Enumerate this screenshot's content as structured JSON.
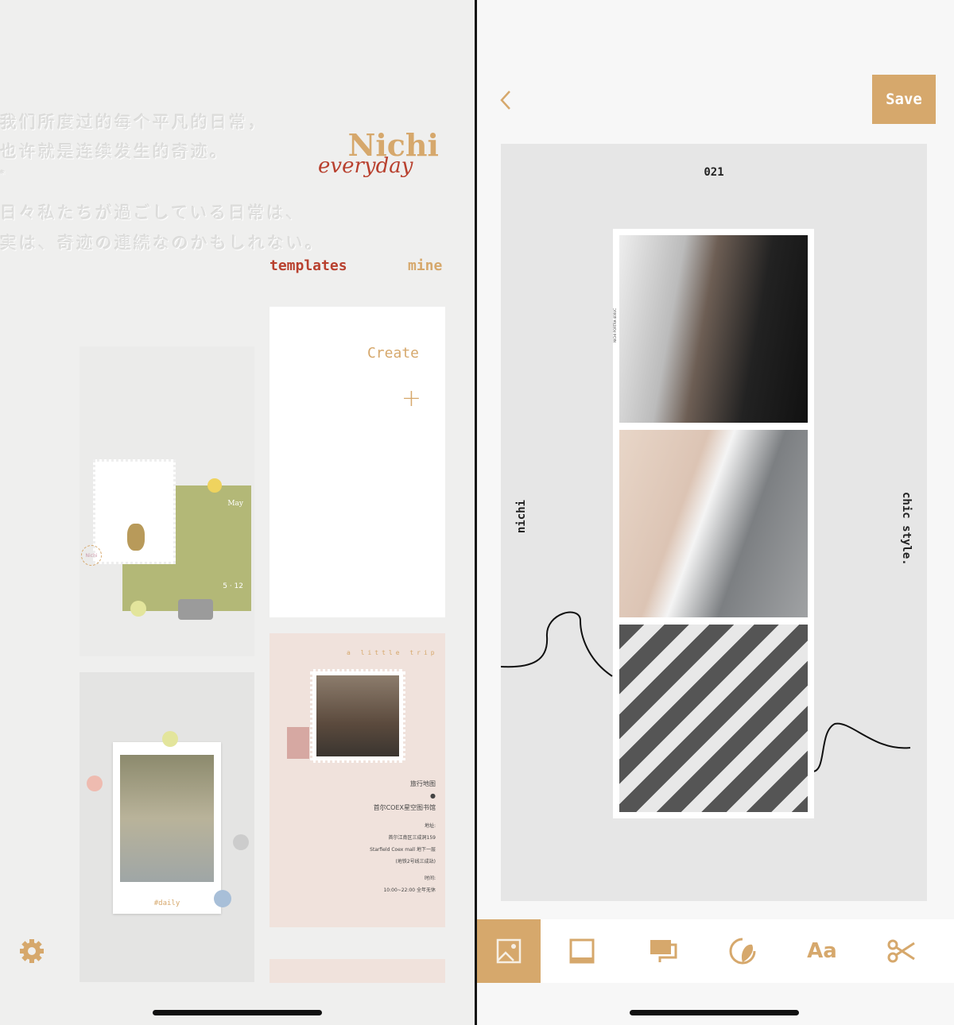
{
  "left": {
    "poem": [
      "我们所度过的每个平凡的日常，",
      "也许就是连续发生的奇迹。",
      "*",
      "日々私たちが過ごしている日常は、",
      "実は、奇迹の連続なのかもしれない。"
    ],
    "logo": {
      "name": "Nichi",
      "script": "everyday"
    },
    "tabs": [
      {
        "label": "templates",
        "active": true
      },
      {
        "label": "mine",
        "active": false
      }
    ],
    "create": {
      "label": "Create",
      "icon": "plus-icon"
    },
    "templates": [
      {
        "month": "May",
        "date": "5 · 12",
        "stamp": "Nichi"
      },
      {
        "tag": "#daily"
      },
      {
        "title": "a little trip",
        "lines": [
          "旅行地图",
          "首尔COEX星空图书馆",
          "地址:",
          "首尔江南区三成洞159",
          "Starfield Coex mall 地下一层",
          "(地铁2号线三成站)",
          "时间:",
          "10:00~22:00 全年无休"
        ]
      }
    ],
    "settings_icon": "gear-icon"
  },
  "right": {
    "back_icon": "chevron-left-icon",
    "save_label": "Save",
    "canvas": {
      "number": "021",
      "left_text": "nichi",
      "right_text": "chic style.",
      "film_label": "NICHI PORTRA 400UC"
    },
    "toolbar": [
      "image-icon",
      "frame-icon",
      "background-icon",
      "sticker-icon",
      "text-icon",
      "scissors-icon"
    ]
  },
  "colors": {
    "accent": "#d6a86c",
    "active_tab": "#b8402e"
  }
}
